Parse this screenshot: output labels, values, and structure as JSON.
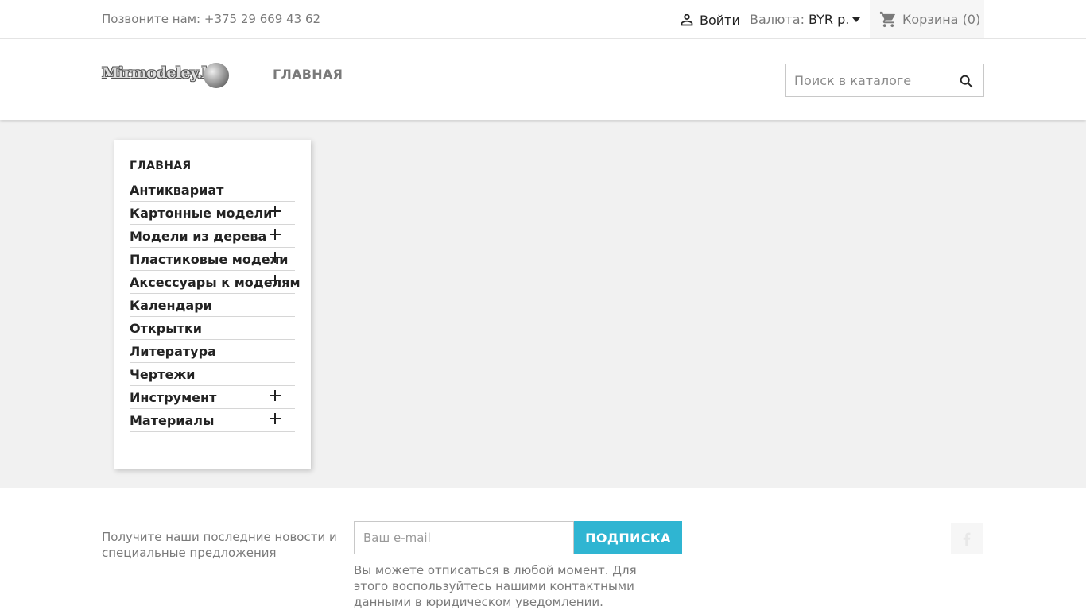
{
  "topbar": {
    "phone_text": "Позвоните нам: +375 29 669 43 62",
    "login_label": "Войти",
    "currency_label": "Валюта:",
    "currency_value": "BYR р.",
    "cart_label": "Корзина (0)"
  },
  "header": {
    "logo_text": "Mirmodeley.by",
    "nav_home": "ГЛАВНАЯ",
    "search_placeholder": "Поиск в каталоге"
  },
  "sidebar": {
    "title": "ГЛАВНАЯ",
    "categories": [
      {
        "label": "Антиквариат",
        "expandable": false
      },
      {
        "label": "Картонные модели",
        "expandable": true
      },
      {
        "label": "Модели из дерева",
        "expandable": true
      },
      {
        "label": "Пластиковые модели",
        "expandable": true
      },
      {
        "label": "Аксессуары к моделям",
        "expandable": true
      },
      {
        "label": "Календари",
        "expandable": false
      },
      {
        "label": "Открытки",
        "expandable": false
      },
      {
        "label": "Литература",
        "expandable": false
      },
      {
        "label": "Чертежи",
        "expandable": false
      },
      {
        "label": "Инструмент",
        "expandable": true
      },
      {
        "label": "Материалы",
        "expandable": true
      }
    ]
  },
  "footer": {
    "newsletter_text": "Получите наши последние новости и специальные предложения",
    "email_placeholder": "Ваш e-mail",
    "subscribe_label": "ПОДПИСКА",
    "unsubscribe_text": "Вы можете отписаться в любой момент. Для этого воспользуйтесь нашими контактными данными в юридическом уведомлении."
  },
  "icons": {
    "login": "user-icon",
    "currency_dropdown": "caret-down-icon",
    "cart": "shopping-cart-icon",
    "search": "search-icon",
    "expand": "plus-icon",
    "social": "facebook-icon"
  },
  "colors": {
    "accent": "#2fb5d2",
    "page_bg": "#f1f1f1",
    "text_dark": "#232323",
    "text_muted": "#7a7a7a"
  }
}
